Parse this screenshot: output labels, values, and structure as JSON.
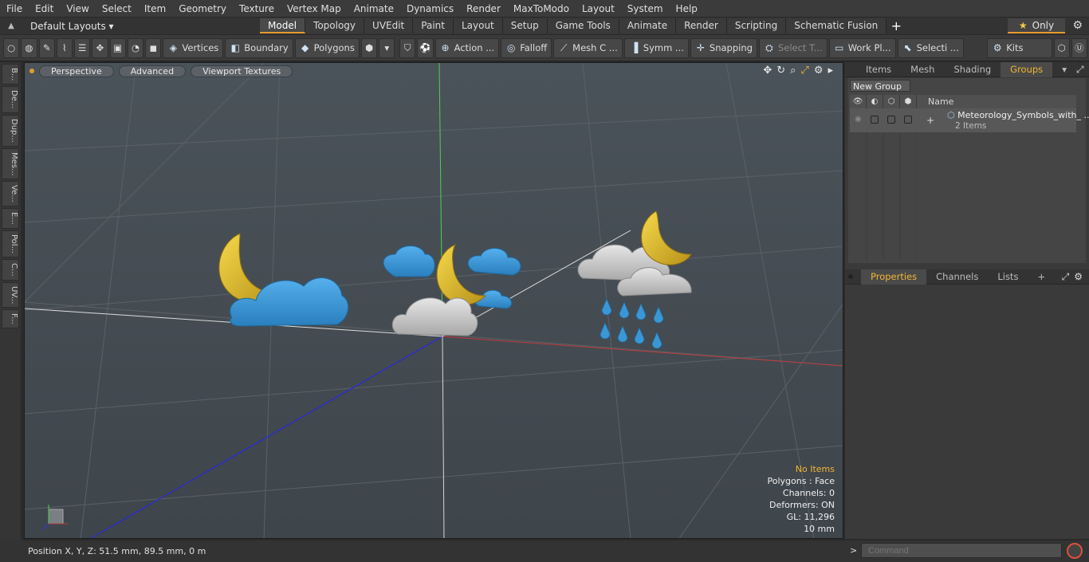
{
  "menu": [
    "File",
    "Edit",
    "View",
    "Select",
    "Item",
    "Geometry",
    "Texture",
    "Vertex Map",
    "Animate",
    "Dynamics",
    "Render",
    "MaxToModo",
    "Layout",
    "System",
    "Help"
  ],
  "layoutbar": {
    "layouts_label": "Default Layouts ▾",
    "tabs": [
      "Model",
      "Topology",
      "UVEdit",
      "Paint",
      "Layout",
      "Setup",
      "Game Tools",
      "Animate",
      "Render",
      "Scripting",
      "Schematic Fusion"
    ],
    "active_tab": "Model",
    "only_label": "Only"
  },
  "toolbar": {
    "vertices": "Vertices",
    "boundary": "Boundary",
    "polygons": "Polygons",
    "action": "Action ...",
    "falloff": "Falloff",
    "mesh": "Mesh C ...",
    "symm": "Symm ...",
    "snapping": "Snapping",
    "select_t": "Select T...",
    "work_pl": "Work Pl...",
    "selecti": "Selecti ...",
    "kits": "Kits"
  },
  "lefttabs": [
    "B...",
    "De...",
    "Dup...",
    "Mes...",
    "Ve...",
    "E...",
    "Pol...",
    "C...",
    "UV...",
    "F..."
  ],
  "viewport": {
    "perspective": "Perspective",
    "advanced": "Advanced",
    "viewport_textures": "Viewport Textures",
    "stats": {
      "selection": "No Items",
      "polygons": "Polygons : Face",
      "channels": "Channels: 0",
      "deformers": "Deformers: ON",
      "gl": "GL: 11,296",
      "unit": "10 mm"
    }
  },
  "rightpanel": {
    "tabs": [
      "Items",
      "Mesh ...",
      "Shading",
      "Groups"
    ],
    "active_tab": "Groups",
    "new_group": "New Group",
    "column_name": "Name",
    "group_name": "Meteorology_Symbols_with_ ...",
    "group_count": "2 Items",
    "prop_tabs": [
      "Properties",
      "Channels",
      "Lists"
    ],
    "prop_active": "Properties"
  },
  "statusbar": {
    "position": "Position X, Y, Z:   51.5 mm, 89.5 mm, 0 m",
    "command_placeholder": "Command"
  },
  "colors": {
    "accent": "#e39b2b",
    "moon": "#e8c12f",
    "cloud_blue": "#3a97d6",
    "cloud_grey": "#c9c9c9"
  }
}
